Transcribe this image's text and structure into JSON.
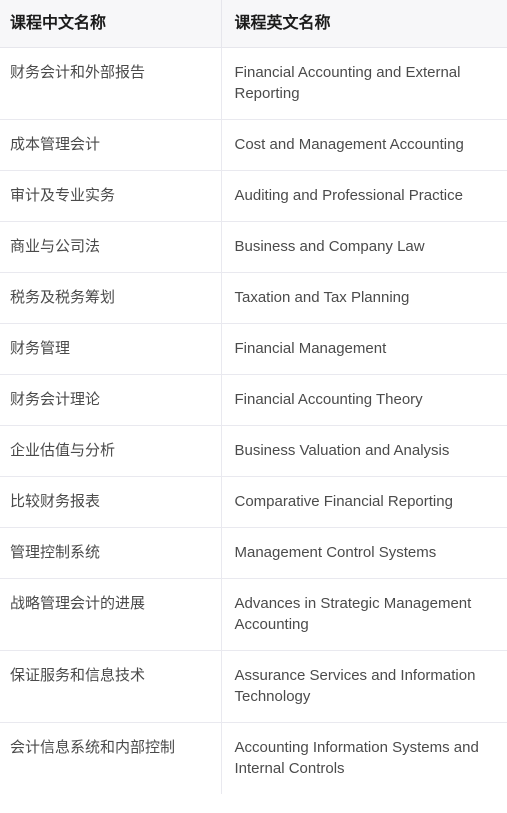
{
  "table": {
    "headers": {
      "chinese": "课程中文名称",
      "english": "课程英文名称"
    },
    "rows": [
      {
        "chinese": "财务会计和外部报告",
        "english": "Financial Accounting and External Reporting"
      },
      {
        "chinese": "成本管理会计",
        "english": "Cost and Management Accounting"
      },
      {
        "chinese": "审计及专业实务",
        "english": "Auditing and Professional Practice"
      },
      {
        "chinese": "商业与公司法",
        "english": "Business and Company Law"
      },
      {
        "chinese": "税务及税务筹划",
        "english": "Taxation and Tax Planning"
      },
      {
        "chinese": "财务管理",
        "english": "Financial Management"
      },
      {
        "chinese": "财务会计理论",
        "english": "Financial Accounting Theory"
      },
      {
        "chinese": "企业估值与分析",
        "english": "Business Valuation and Analysis"
      },
      {
        "chinese": "比较财务报表",
        "english": "Comparative Financial Reporting"
      },
      {
        "chinese": "管理控制系统",
        "english": "Management Control Systems"
      },
      {
        "chinese": "战略管理会计的进展",
        "english": "Advances in Strategic Management Accounting"
      },
      {
        "chinese": "保证服务和信息技术",
        "english": "Assurance Services and Information Technology"
      },
      {
        "chinese": "会计信息系统和内部控制",
        "english": "Accounting Information Systems and Internal Controls"
      }
    ]
  },
  "colors": {
    "header_background": "#f7f7f9",
    "header_text": "#1b1b1b",
    "body_text": "#4a4a4a",
    "border": "#e9e9ef",
    "page_background": "#ffffff"
  }
}
